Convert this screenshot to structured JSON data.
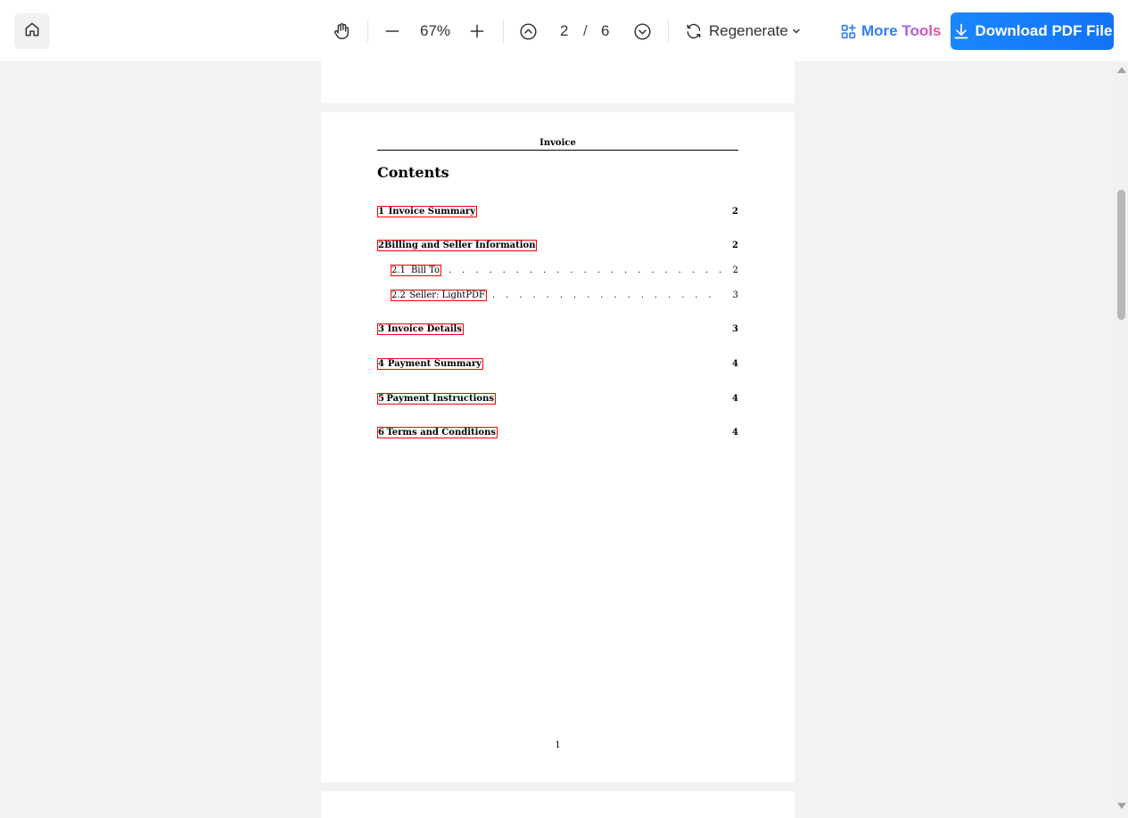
{
  "toolbar": {
    "home_icon": "home-icon",
    "pan_icon": "hand-icon",
    "zoom_out_icon": "minus-icon",
    "zoom_level": "67%",
    "zoom_in_icon": "plus-icon",
    "prev_page_icon": "chevron-up-circle-icon",
    "current_page": "2",
    "page_separator": "/",
    "total_pages": "6",
    "next_page_icon": "chevron-down-circle-icon",
    "regenerate_label": "Regenerate",
    "more_tools_word1": "More",
    "more_tools_word2": "Tools",
    "download_label": "Download PDF File",
    "accent_color": "#1a86ff"
  },
  "document": {
    "running_header": "Invoice",
    "contents_title": "Contents",
    "toc": [
      {
        "num": "1",
        "title": "Invoice Summary",
        "page": "2",
        "level": 1
      },
      {
        "num": "2",
        "title": "Billing and Seller Information",
        "page": "2",
        "level": 1
      },
      {
        "num": "2.1",
        "title": "Bill To",
        "page": "2",
        "level": 2
      },
      {
        "num": "2.2",
        "title": "Seller: LightPDF",
        "page": "3",
        "level": 2
      },
      {
        "num": "3",
        "title": "Invoice Details",
        "page": "3",
        "level": 1
      },
      {
        "num": "4",
        "title": "Payment Summary",
        "page": "4",
        "level": 1
      },
      {
        "num": "5",
        "title": "Payment Instructions",
        "page": "4",
        "level": 1
      },
      {
        "num": "6",
        "title": "Terms and Conditions",
        "page": "4",
        "level": 1
      }
    ],
    "page_number": "1"
  }
}
